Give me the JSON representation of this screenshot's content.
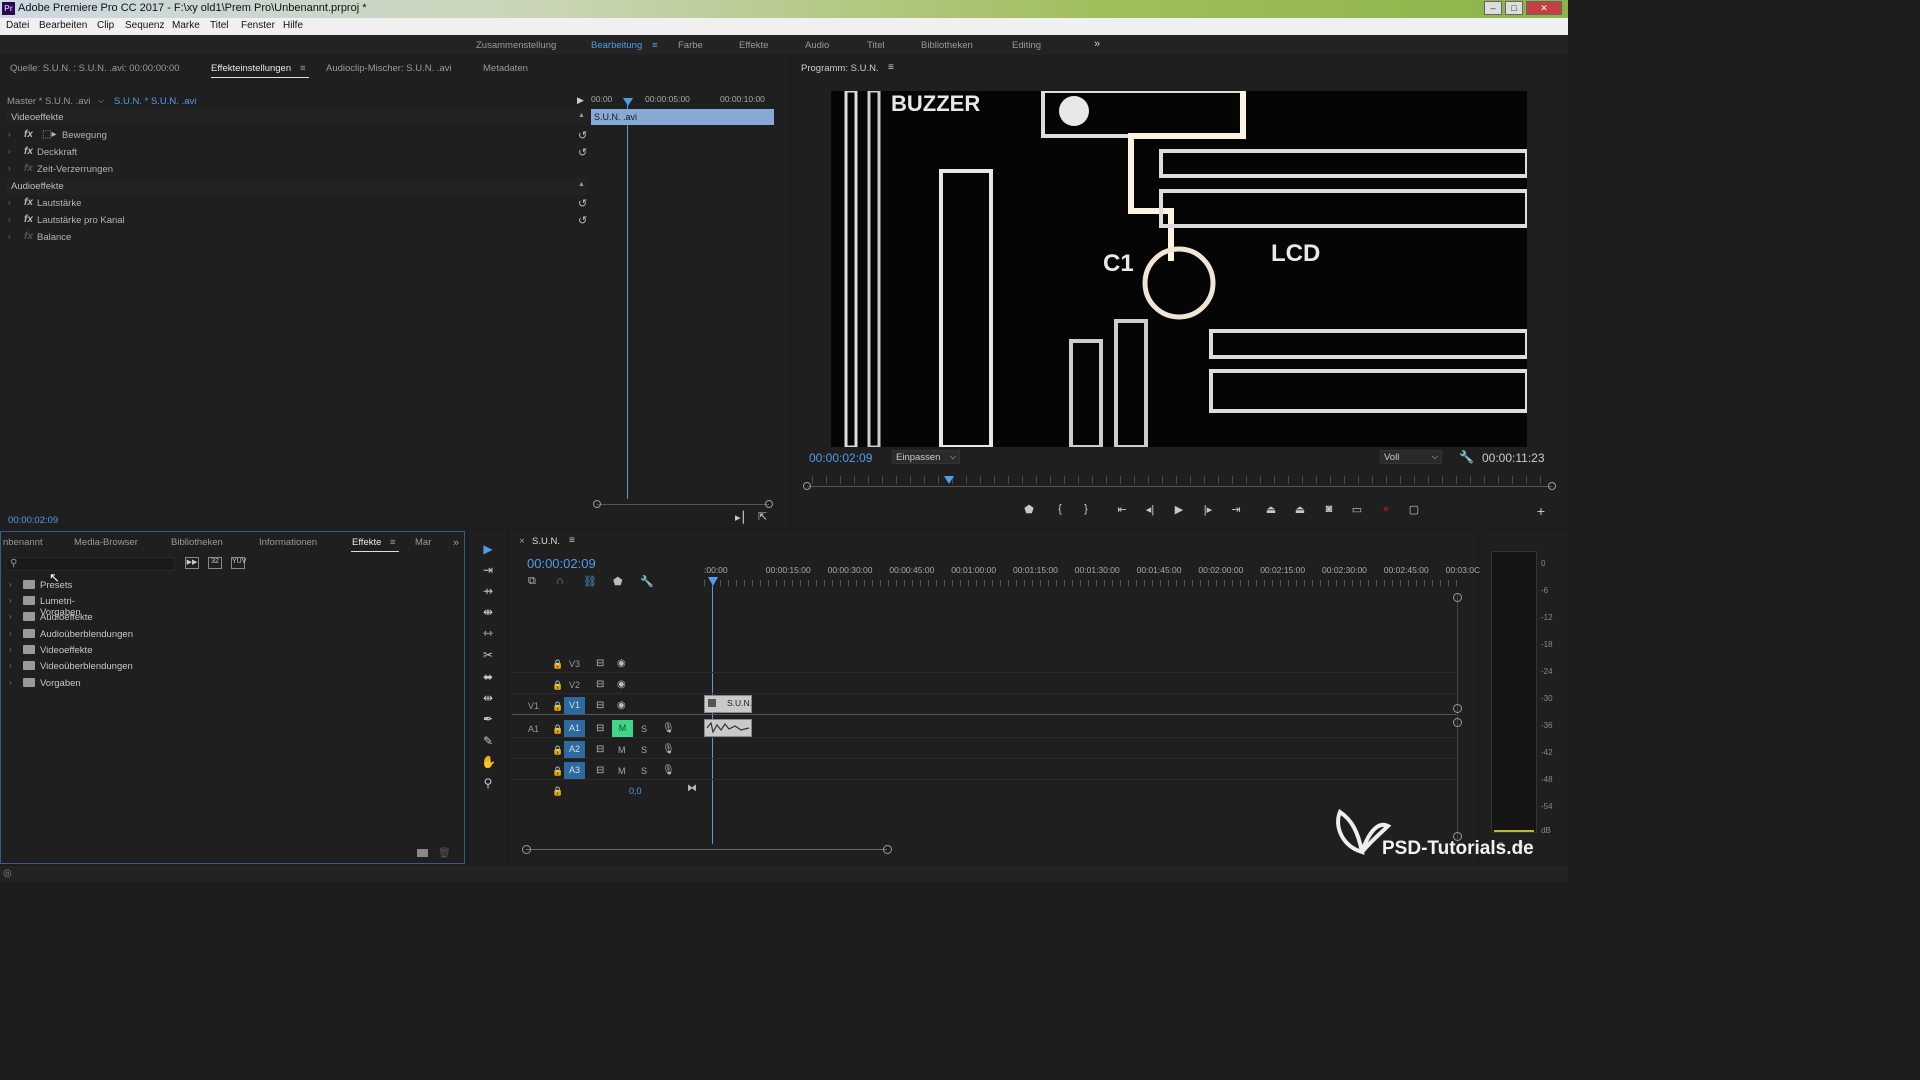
{
  "window": {
    "app_icon": "Pr",
    "title": "Adobe Premiere Pro CC 2017 - F:\\xy old1\\Prem Pro\\Unbenannt.prproj *",
    "minimize": "–",
    "maximize": "□",
    "close": "✕"
  },
  "menu": [
    "Datei",
    "Bearbeiten",
    "Clip",
    "Sequenz",
    "Marke",
    "Titel",
    "Fenster",
    "Hilfe"
  ],
  "workspaces": {
    "items": [
      "Zusammenstellung",
      "Bearbeitung",
      "Farbe",
      "Effekte",
      "Audio",
      "Titel",
      "Bibliotheken",
      "Editing"
    ],
    "active": "Bearbeitung",
    "more": "»"
  },
  "source_panel": {
    "tabs": [
      "Quelle: S.U.N. : S.U.N. .avi: 00:00:00:00",
      "Effekteinstellungen",
      "Audioclip-Mischer: S.U.N. .avi",
      "Metadaten"
    ],
    "active_tab": "Effekteinstellungen",
    "master_label": "Master * S.U.N. .avi",
    "clip_label": "S.U.N. * S.U.N. .avi",
    "ruler": [
      "00:00",
      "00:00:05:00",
      "00:00:10:00"
    ],
    "clip_bar": "S.U.N. .avi",
    "sections": {
      "video": "Videoeffekte",
      "audio": "Audioeffekte"
    },
    "video_effects": [
      "Bewegung",
      "Deckkraft",
      "Zeit-Verzerrungen"
    ],
    "audio_effects": [
      "Lautstärke",
      "Lautstärke pro Kanal",
      "Balance"
    ],
    "timecode": "00:00:02:09"
  },
  "program_monitor": {
    "title": "Programm: S.U.N.",
    "timecode": "00:00:02:09",
    "fit": "Einpassen",
    "quality": "Voll",
    "duration": "00:00:11:23",
    "playhead_fraction": 0.19,
    "video_text": [
      "BUZZER",
      "C1",
      "LCD"
    ]
  },
  "project_panel": {
    "tabs": [
      "nbenannt",
      "Media-Browser",
      "Bibliotheken",
      "Informationen",
      "Effekte",
      "Mar"
    ],
    "active_tab": "Effekte",
    "folders": [
      "Presets",
      "Lumetri-Vorgaben",
      "Audioeffekte",
      "Audioüberblendungen",
      "Videoeffekte",
      "Videoüberblendungen",
      "Vorgaben"
    ]
  },
  "timeline": {
    "tab": "S.U.N.",
    "timecode": "00:00:02:09",
    "ruler": [
      ":00:00",
      "00:00:15:00",
      "00:00:30:00",
      "00:00:45:00",
      "00:01:00:00",
      "00:01:15:00",
      "00:01:30:00",
      "00:01:45:00",
      "00:02:00:00",
      "00:02:15:00",
      "00:02:30:00",
      "00:02:45:00",
      "00:03:0C"
    ],
    "video_tracks": [
      "V3",
      "V2",
      "V1"
    ],
    "audio_tracks": [
      "A1",
      "A2",
      "A3"
    ],
    "source_v": "V1",
    "source_a": "A1",
    "mute": "M",
    "solo": "S",
    "master_value": "0,0",
    "clip_label": "S.U.N."
  },
  "meter": {
    "labels": [
      "0",
      "-6",
      "-12",
      "-18",
      "-24",
      "-30",
      "-36",
      "-42",
      "-48",
      "-54",
      "dB"
    ],
    "channels": [
      "S",
      "S"
    ]
  },
  "watermark": "PSD-Tutorials.de",
  "colors": {
    "accent": "#4e9de6",
    "mute_active": "#3fd68a",
    "clip_bar": "#87a9d6"
  }
}
